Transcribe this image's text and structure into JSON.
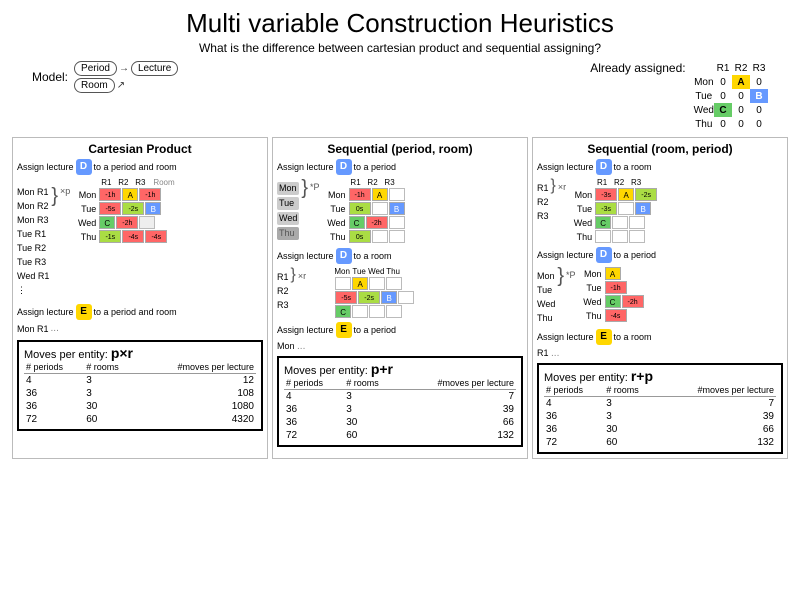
{
  "title": "Multi variable Construction Heuristics",
  "subtitle": "What is the difference between cartesian product and sequential assigning?",
  "model": {
    "label": "Model:",
    "period": "Period",
    "room": "Room",
    "lecture": "Lecture"
  },
  "already_assigned": {
    "label": "Already assigned:",
    "headers": [
      "R1",
      "R2",
      "R3"
    ],
    "rows": [
      {
        "day": "Mon",
        "cells": [
          "0",
          "A",
          "0"
        ]
      },
      {
        "day": "Tue",
        "cells": [
          "0",
          "0",
          "B"
        ]
      },
      {
        "day": "Wed",
        "cells": [
          "C",
          "0",
          "0"
        ]
      },
      {
        "day": "Thu",
        "cells": [
          "0",
          "0",
          "0"
        ]
      }
    ]
  },
  "col1": {
    "title": "Cartesian Product",
    "assign1": "Assign lecture D to a period and room",
    "days1": [
      "Mon",
      "Mon",
      "Mon",
      "Tue",
      "Tue",
      "Tue",
      "Wed"
    ],
    "rooms1": [
      "R1",
      "R2",
      "R3"
    ],
    "schedule1": {
      "headers": [
        "R1",
        "R2",
        "R3"
      ],
      "rows": [
        {
          "day": "Mon",
          "cells": [
            "-1h",
            "A",
            "-1h"
          ]
        },
        {
          "day": "Tue",
          "cells": [
            "-5s",
            "-2s",
            "B"
          ]
        },
        {
          "day": "Wed",
          "cells": [
            "C",
            "-2h",
            ""
          ]
        },
        {
          "day": "Thu",
          "cells": [
            "-1s",
            "-4s",
            "-4s"
          ]
        }
      ]
    },
    "assign2": "Assign lecture E to a period and room",
    "moves_label": "Moves per entity:",
    "moves_formula": "p×r",
    "table": {
      "headers": [
        "# periods",
        "# rooms",
        "#moves per lecture"
      ],
      "rows": [
        [
          "4",
          "3",
          "12"
        ],
        [
          "36",
          "3",
          "108"
        ],
        [
          "36",
          "30",
          "1080"
        ],
        [
          "72",
          "60",
          "4320"
        ]
      ]
    }
  },
  "col2": {
    "title": "Sequential (period, room)",
    "assign1": "Assign lecture D to a period",
    "days1": [
      "Mon",
      "Tue",
      "Wed",
      "Thu"
    ],
    "schedule1": {
      "headers": [
        "R1",
        "R2",
        "R3"
      ],
      "rows": [
        {
          "day": "Mon",
          "cells": [
            "-1h",
            "A",
            ""
          ]
        },
        {
          "day": "Tue",
          "cells": [
            "0s",
            "",
            "B"
          ]
        },
        {
          "day": "Wed",
          "cells": [
            "C",
            "-2h",
            ""
          ]
        },
        {
          "day": "Thu",
          "cells": [
            "0s",
            "",
            ""
          ]
        }
      ]
    },
    "assign2": "Assign lecture D to a room",
    "schedule2": {
      "rows": [
        {
          "room": "R1",
          "cells": [
            "",
            "A",
            ""
          ]
        },
        {
          "room": "R2",
          "cells": [
            "-5s",
            "-2s",
            "B"
          ]
        },
        {
          "room": "R3",
          "cells": [
            "C",
            "",
            ""
          ]
        }
      ]
    },
    "assign3": "Assign lecture E to a period",
    "days3": [
      "Mon"
    ],
    "moves_label": "Moves per entity:",
    "moves_formula": "p+r",
    "table": {
      "headers": [
        "# periods",
        "# rooms",
        "#moves per lecture"
      ],
      "rows": [
        [
          "4",
          "3",
          "7"
        ],
        [
          "36",
          "3",
          "39"
        ],
        [
          "36",
          "30",
          "66"
        ],
        [
          "72",
          "60",
          "132"
        ]
      ]
    }
  },
  "col3": {
    "title": "Sequential (room, period)",
    "assign1": "Assign lecture D to a room",
    "rooms1": [
      "R1",
      "R2",
      "R3"
    ],
    "schedule1": {
      "headers": [
        "R1",
        "R2",
        "R3"
      ],
      "rows": [
        {
          "day": "Mon",
          "cells": [
            "-3s",
            "A",
            "-2s"
          ]
        },
        {
          "day": "Tue",
          "cells": [
            "-3s",
            "",
            "B"
          ]
        },
        {
          "day": "Wed",
          "cells": [
            "C",
            "",
            ""
          ]
        },
        {
          "day": "Thu",
          "cells": [
            "",
            "",
            ""
          ]
        }
      ]
    },
    "assign2": "Assign lecture D to a period",
    "schedule2": {
      "rows": [
        {
          "day": "Mon",
          "cells": [
            "",
            "A",
            ""
          ]
        },
        {
          "day": "Tue",
          "cells": [
            "",
            "",
            "-1h"
          ]
        },
        {
          "day": "Wed",
          "cells": [
            "C",
            "",
            ""
          ]
        },
        {
          "day": "Thu",
          "cells": [
            "",
            "",
            "-2h"
          ]
        }
      ]
    },
    "extra_cell": "-4s",
    "assign3": "Assign lecture E to a room",
    "rooms3": [
      "R1"
    ],
    "moves_label": "Moves per entity:",
    "moves_formula": "r+p",
    "table": {
      "headers": [
        "# periods",
        "# rooms",
        "#moves per lecture"
      ],
      "rows": [
        [
          "4",
          "3",
          "7"
        ],
        [
          "36",
          "3",
          "39"
        ],
        [
          "36",
          "30",
          "66"
        ],
        [
          "72",
          "60",
          "132"
        ]
      ]
    }
  }
}
